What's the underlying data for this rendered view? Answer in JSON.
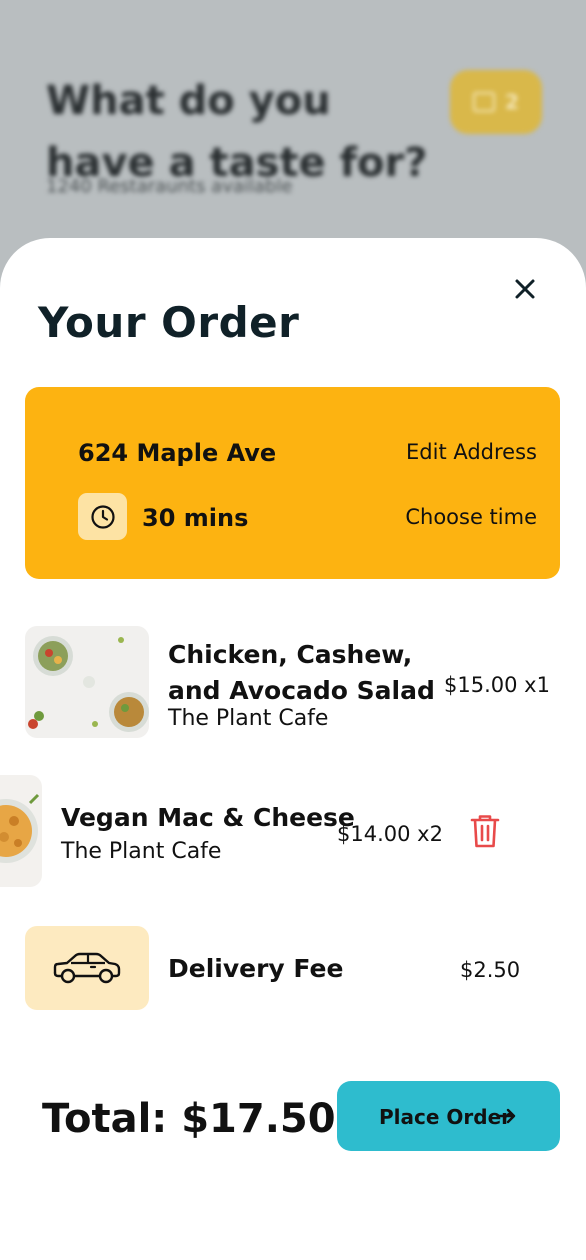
{
  "background": {
    "title": "What do you have a taste for?",
    "subtitle": "1240 Restaraunts available",
    "cart_count": "2"
  },
  "order": {
    "title": "Your Order",
    "address": "624 Maple Ave",
    "edit_address": "Edit Address",
    "eta": "30 mins",
    "choose_time": "Choose time",
    "items": [
      {
        "name": "Chicken, Cashew, and Avocado Salad",
        "name_line1": "Chicken, Cashew,",
        "name_line2": "and Avocado Salad",
        "restaurant": "The Plant Cafe",
        "price_qty": "$15.00 x1"
      },
      {
        "name": "Vegan Mac & Cheese",
        "restaurant": "The Plant Cafe",
        "price_qty": "$14.00 x2"
      }
    ],
    "delivery_fee_label": "Delivery Fee",
    "delivery_fee": "$2.50",
    "total": "Total: $17.50",
    "place_order": "Place Order"
  },
  "colors": {
    "accent_yellow": "#fdb311",
    "button_teal": "#2ebcce",
    "delete_red": "#e84a4a"
  },
  "icons": [
    "close-icon",
    "clock-icon",
    "trash-icon",
    "car-icon",
    "arrow-right-icon",
    "bag-icon"
  ]
}
